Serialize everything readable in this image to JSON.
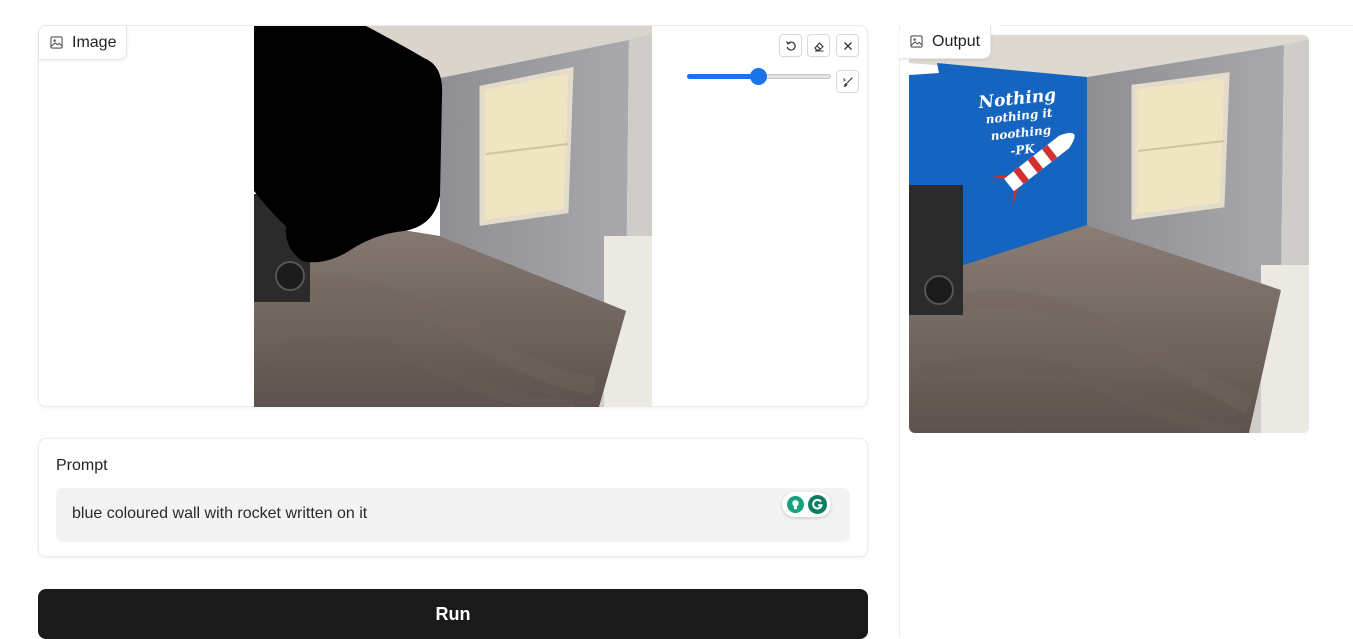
{
  "input_panel": {
    "label": "Image",
    "label_icon": "image-icon",
    "toolbar": {
      "undo_icon": "undo-icon",
      "eraser_icon": "eraser-icon",
      "close_icon": "close-icon",
      "brush_icon": "brush-icon",
      "brush_size_fraction": 0.49
    }
  },
  "prompt_panel": {
    "label": "Prompt",
    "value": "blue coloured wall with rocket written on it",
    "grammarly_icons": [
      "bulb-icon",
      "grammarly-icon"
    ]
  },
  "run_button": {
    "label": "Run"
  },
  "output_panel": {
    "label": "Output",
    "label_icon": "image-icon",
    "mural_text": [
      "Nothing",
      "nothing it",
      "noothing",
      "-PK"
    ]
  },
  "colors": {
    "accent": "#1a73e8",
    "run_button_bg": "#1a1a1a",
    "mural_blue": "#1565c0"
  }
}
